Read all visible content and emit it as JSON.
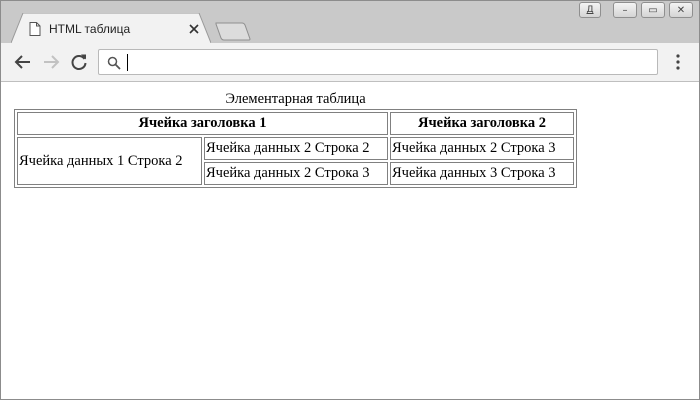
{
  "browser": {
    "tab": {
      "title": "HTML таблица"
    },
    "window_controls": {
      "profile": "Д",
      "minimize": "–",
      "restore": "▭",
      "close": "✕"
    },
    "omnibox": {
      "value": "",
      "placeholder": ""
    }
  },
  "page": {
    "table": {
      "caption": "Элементарная таблица",
      "headers": [
        "Ячейка заголовка 1",
        "Ячейка заголовка 2"
      ],
      "rows": [
        [
          "Ячейка данных 1 Строка 2",
          "Ячейка данных 2 Строка 2",
          "Ячейка данных 2 Строка 3"
        ],
        [
          "Ячейка данных 2 Строка 3",
          "Ячейка данных 3 Строка 3"
        ]
      ]
    }
  }
}
